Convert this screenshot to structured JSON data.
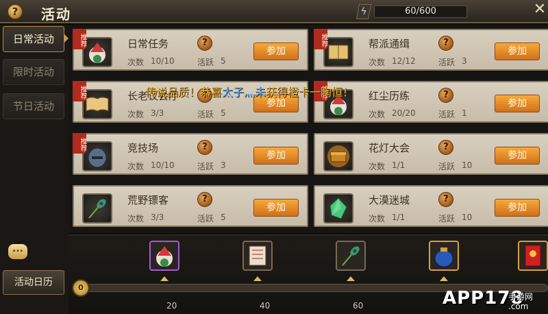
{
  "header": {
    "help_symbol": "?",
    "title": "活动",
    "energy_icon": "lightning-icon",
    "energy_text": "60/600",
    "energy_fraction": 0.1,
    "close_symbol": "✕"
  },
  "sidebar": {
    "tabs": [
      {
        "label": "日常活动",
        "active": true
      },
      {
        "label": "限时活动",
        "active": false
      },
      {
        "label": "节日活动",
        "active": false
      }
    ],
    "chat_symbol": "...",
    "calendar_label": "活动日历"
  },
  "cards": [
    {
      "name": "日常任务",
      "recommended": true,
      "count_label": "次数",
      "count": "10/10",
      "activity_label": "活跃",
      "activity": "5",
      "join_label": "参加",
      "icon": "cake-icon",
      "help": "?",
      "tag": "推荐"
    },
    {
      "name": "帮派通缉",
      "recommended": true,
      "count_label": "次数",
      "count": "12/12",
      "activity_label": "活跃",
      "activity": "3",
      "join_label": "参加",
      "icon": "scroll-book-icon",
      "help": "?",
      "tag": "推荐"
    },
    {
      "name": "长老议会厅",
      "recommended": true,
      "count_label": "次数",
      "count": "3/3",
      "activity_label": "活跃",
      "activity": "5",
      "join_label": "参加",
      "icon": "open-book-icon",
      "help": "?",
      "tag": "推荐"
    },
    {
      "name": "红尘历练",
      "recommended": true,
      "count_label": "次数",
      "count": "20/20",
      "activity_label": "活跃",
      "activity": "1",
      "join_label": "参加",
      "icon": "cake-icon",
      "help": "?",
      "tag": "推荐"
    },
    {
      "name": "竞技场",
      "recommended": true,
      "count_label": "次数",
      "count": "10/10",
      "activity_label": "活跃",
      "activity": "3",
      "join_label": "参加",
      "icon": "helmet-icon",
      "help": "?",
      "tag": "推荐"
    },
    {
      "name": "花灯大会",
      "recommended": false,
      "count_label": "次数",
      "count": "1/1",
      "activity_label": "活跃",
      "activity": "10",
      "join_label": "参加",
      "icon": "treasure-chest-icon",
      "help": "?",
      "tag": ""
    },
    {
      "name": "荒野镖客",
      "recommended": false,
      "count_label": "次数",
      "count": "3/3",
      "activity_label": "活跃",
      "activity": "5",
      "join_label": "参加",
      "icon": "peacock-feather-icon",
      "help": "?",
      "tag": ""
    },
    {
      "name": "大漠迷城",
      "recommended": false,
      "count_label": "次数",
      "count": "1/1",
      "activity_label": "活跃",
      "activity": "10",
      "join_label": "参加",
      "icon": "green-crystal-icon",
      "help": "?",
      "tag": ""
    }
  ],
  "marquee": {
    "part1": "传说品质！恭喜",
    "player": "太子灬未",
    "part2": "获得橙卡一陶恒！"
  },
  "progress": {
    "score": "0",
    "ticks": [
      "20",
      "40",
      "60"
    ],
    "rewards": [
      {
        "icon": "cake-icon"
      },
      {
        "icon": "scroll-icon"
      },
      {
        "icon": "peacock-feather-icon"
      },
      {
        "icon": "money-bag-icon"
      },
      {
        "icon": "red-envelope-icon"
      }
    ]
  },
  "watermark": {
    "main": "APP178",
    "sub": "手游网",
    "domain": ".com"
  }
}
